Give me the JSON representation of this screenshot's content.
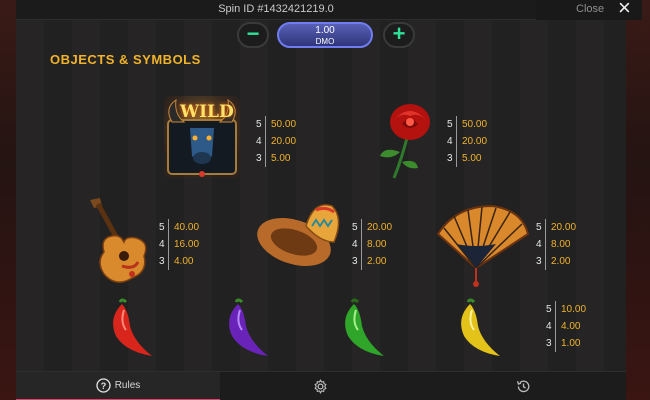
{
  "header": {
    "spin_id": "Spin ID #1432421219.0",
    "close_label": "Close"
  },
  "bet": {
    "value": "1.00",
    "unit": "DMO",
    "minus_label": "−",
    "plus_label": "+"
  },
  "section": {
    "title": "OBJECTS & SYMBOLS"
  },
  "symbols": [
    {
      "name": "wild-bull",
      "label": "WILD",
      "pays": [
        {
          "count": "5",
          "value": "50.00"
        },
        {
          "count": "4",
          "value": "20.00"
        },
        {
          "count": "3",
          "value": "5.00"
        }
      ]
    },
    {
      "name": "rose",
      "pays": [
        {
          "count": "5",
          "value": "50.00"
        },
        {
          "count": "4",
          "value": "20.00"
        },
        {
          "count": "3",
          "value": "5.00"
        }
      ]
    },
    {
      "name": "guitar",
      "pays": [
        {
          "count": "5",
          "value": "40.00"
        },
        {
          "count": "4",
          "value": "16.00"
        },
        {
          "count": "3",
          "value": "4.00"
        }
      ]
    },
    {
      "name": "sombrero",
      "pays": [
        {
          "count": "5",
          "value": "20.00"
        },
        {
          "count": "4",
          "value": "8.00"
        },
        {
          "count": "3",
          "value": "2.00"
        }
      ]
    },
    {
      "name": "fan",
      "pays": [
        {
          "count": "5",
          "value": "20.00"
        },
        {
          "count": "4",
          "value": "8.00"
        },
        {
          "count": "3",
          "value": "2.00"
        }
      ]
    },
    {
      "name": "peppers",
      "pays": [
        {
          "count": "5",
          "value": "10.00"
        },
        {
          "count": "4",
          "value": "4.00"
        },
        {
          "count": "3",
          "value": "1.00"
        }
      ]
    }
  ],
  "peppers_colors": [
    "#d8261c",
    "#6a23b8",
    "#2fa62a",
    "#e3c21a"
  ],
  "colors": {
    "accent_gold": "#f0b32a",
    "accent_green": "#2ee29a",
    "tab_active": "#e0406e"
  },
  "tabs": [
    {
      "label": "Rules",
      "icon": "question-icon"
    },
    {
      "label": "",
      "icon": "gear-icon"
    },
    {
      "label": "",
      "icon": "history-icon"
    }
  ]
}
